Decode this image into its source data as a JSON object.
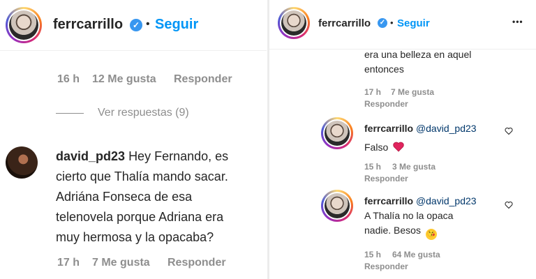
{
  "left": {
    "header": {
      "username": "ferrcarrillo",
      "dot": "•",
      "follow": "Seguir"
    },
    "prev_meta": {
      "time": "16 h",
      "likes": "12 Me gusta",
      "reply": "Responder"
    },
    "view_replies": "Ver respuestas (9)",
    "comment": {
      "username": "david_pd23",
      "lines": [
        "Hey Fernando, es",
        "cierto que Thalía mando sacar.",
        "Adriána Fonseca de esa",
        "telenovela porque Adriana era",
        "muy hermosa y la opacaba?"
      ],
      "time": "17 h",
      "likes": "7 Me gusta",
      "reply": "Responder"
    }
  },
  "right": {
    "header": {
      "username": "ferrcarrillo",
      "dot": "•",
      "follow": "Seguir",
      "more": "•••"
    },
    "prev_lines": [
      "era una belleza en aquel",
      "entonces"
    ],
    "prev_meta": {
      "time": "17 h",
      "likes": "7 Me gusta",
      "reply": "Responder"
    },
    "replies": [
      {
        "username": "ferrcarrillo",
        "mention": "@david_pd23",
        "text": "Falso",
        "emoji": "heart",
        "time": "15 h",
        "likes": "3 Me gusta",
        "reply": "Responder"
      },
      {
        "username": "ferrcarrillo",
        "mention": "@david_pd23",
        "lines": [
          "A Thalía no la opaca",
          "nadie. Besos"
        ],
        "emoji": "kiss-face",
        "time": "15 h",
        "likes": "64 Me gusta",
        "reply": "Responder"
      }
    ]
  },
  "colors": {
    "link": "#0095f6",
    "verified": "#3897f0",
    "meta": "#8e8e8e",
    "mention": "#00376b"
  }
}
